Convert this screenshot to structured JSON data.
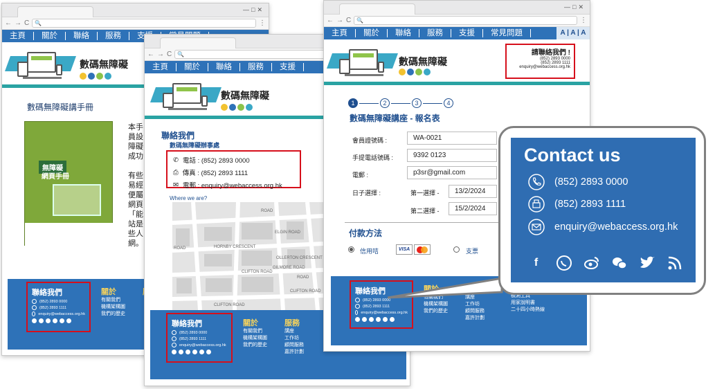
{
  "nav_items": [
    "主頁",
    "關於",
    "聯絡",
    "服務",
    "支援",
    "常見問題"
  ],
  "site_name": "數碼無障礙",
  "font_size_toggle": "A | A | A",
  "window1": {
    "page_heading": "數碼無障礙講手冊",
    "book_title": "無障礙",
    "book_subtitle": "網頁手冊",
    "body_text": [
      "本手",
      "員設",
      "障礙",
      "成功",
      "有些",
      "易經",
      "便屬",
      "網頁",
      "「能",
      "站是",
      "些人",
      "網。"
    ],
    "footer": {
      "contact_title": "聯絡我們",
      "phone": "(852) 2893 0000",
      "fax": "(852) 2893 1111",
      "email": "enquiry@webaccess.org.hk",
      "col2_title": "關於",
      "col2_items": [
        "有關我們",
        "機構架構圖",
        "我們的歷史"
      ],
      "col3_title": "服"
    }
  },
  "window2": {
    "contact_heading": "聯絡我們",
    "contact_subheading": "數碼無障礙辦事處",
    "phone_label": "電話 : (852) 2893 0000",
    "fax_label": "傳真 : (852) 2893 1111",
    "email_label": "電郵 : enquiry@webaccess.org.hk",
    "map_label": "Where we are?",
    "map_streets": [
      "ROAD",
      "ROAD",
      "ROAD",
      "ELGIN ROAD",
      "HORNBY CRESCENT",
      "OLLERTON CRESCENT",
      "CLIFTON ROAD",
      "GILMORE ROAD",
      "CLIFTON ROAD",
      "CLIFTON ROAD"
    ],
    "footer": {
      "contact_title": "聯絡我們",
      "phone": "(852) 2893 0000",
      "fax": "(852) 2893 1111",
      "email": "enquiry@webaccess.org.hk",
      "col2_title": "關於",
      "col2_items": [
        "有關我們",
        "機構架構圖",
        "我們的歷史"
      ],
      "col3_title": "服務",
      "col3_items": [
        "講座",
        "工作坊",
        "顧問服務",
        "嘉許計劃"
      ]
    }
  },
  "window3": {
    "header_contact_title": "請聯絡我們 !",
    "header_phone": "(852) 2893 0000",
    "header_fax": "(852) 2893 1111",
    "header_email": "enquiry@webaccess.org.hk",
    "steps": [
      "1",
      "2",
      "3",
      "4"
    ],
    "form_title": "數碼無障礙講座 - 報名表",
    "labels": {
      "member_no": "會員證號碼 :",
      "mobile": "手提電話號碼 :",
      "email": "電郵 :",
      "date": "日子選擇 :",
      "first_choice": "第一選擇 -",
      "second_choice": "第二選擇 -"
    },
    "values": {
      "member_no": "WA-0021",
      "mobile": "9392 0123",
      "email": "p3sr@gmail.com",
      "first_choice": "13/2/2024",
      "second_choice": "15/2/2024"
    },
    "payment_title": "付款方法",
    "payment_credit": "信用咭",
    "payment_cheque": "支票",
    "card_visa": "VISA",
    "card_mc": "MasterCard",
    "footer": {
      "contact_title": "聯絡我們",
      "phone": "(852) 2893 0000",
      "fax": "(852) 2893 1111",
      "email": "enquiry@webaccess.org.hk",
      "col2_title": "關於",
      "col2_items": [
        "有關我們",
        "機構架構圖",
        "我們的歷史"
      ],
      "col3_title": "服務",
      "col3_items": [
        "講座",
        "工作坊",
        "顧問服務",
        "嘉許計劃"
      ],
      "col4_items": [
        "檢測工具",
        "用家說明書",
        "二十四小時熱線"
      ]
    }
  },
  "callout": {
    "title": "Contact us",
    "phone": "(852) 2893 0000",
    "fax": "(852) 2893 1111",
    "email": "enquiry@webaccess.org.hk",
    "social_icons": [
      "facebook-icon",
      "whatsapp-icon",
      "weibo-icon",
      "wechat-icon",
      "twitter-icon",
      "rss-icon"
    ]
  },
  "colors": {
    "nav": "#2e72b8",
    "highlight": "#d60f1b",
    "heading": "#f7d35c",
    "panel": "#2f6db2"
  }
}
